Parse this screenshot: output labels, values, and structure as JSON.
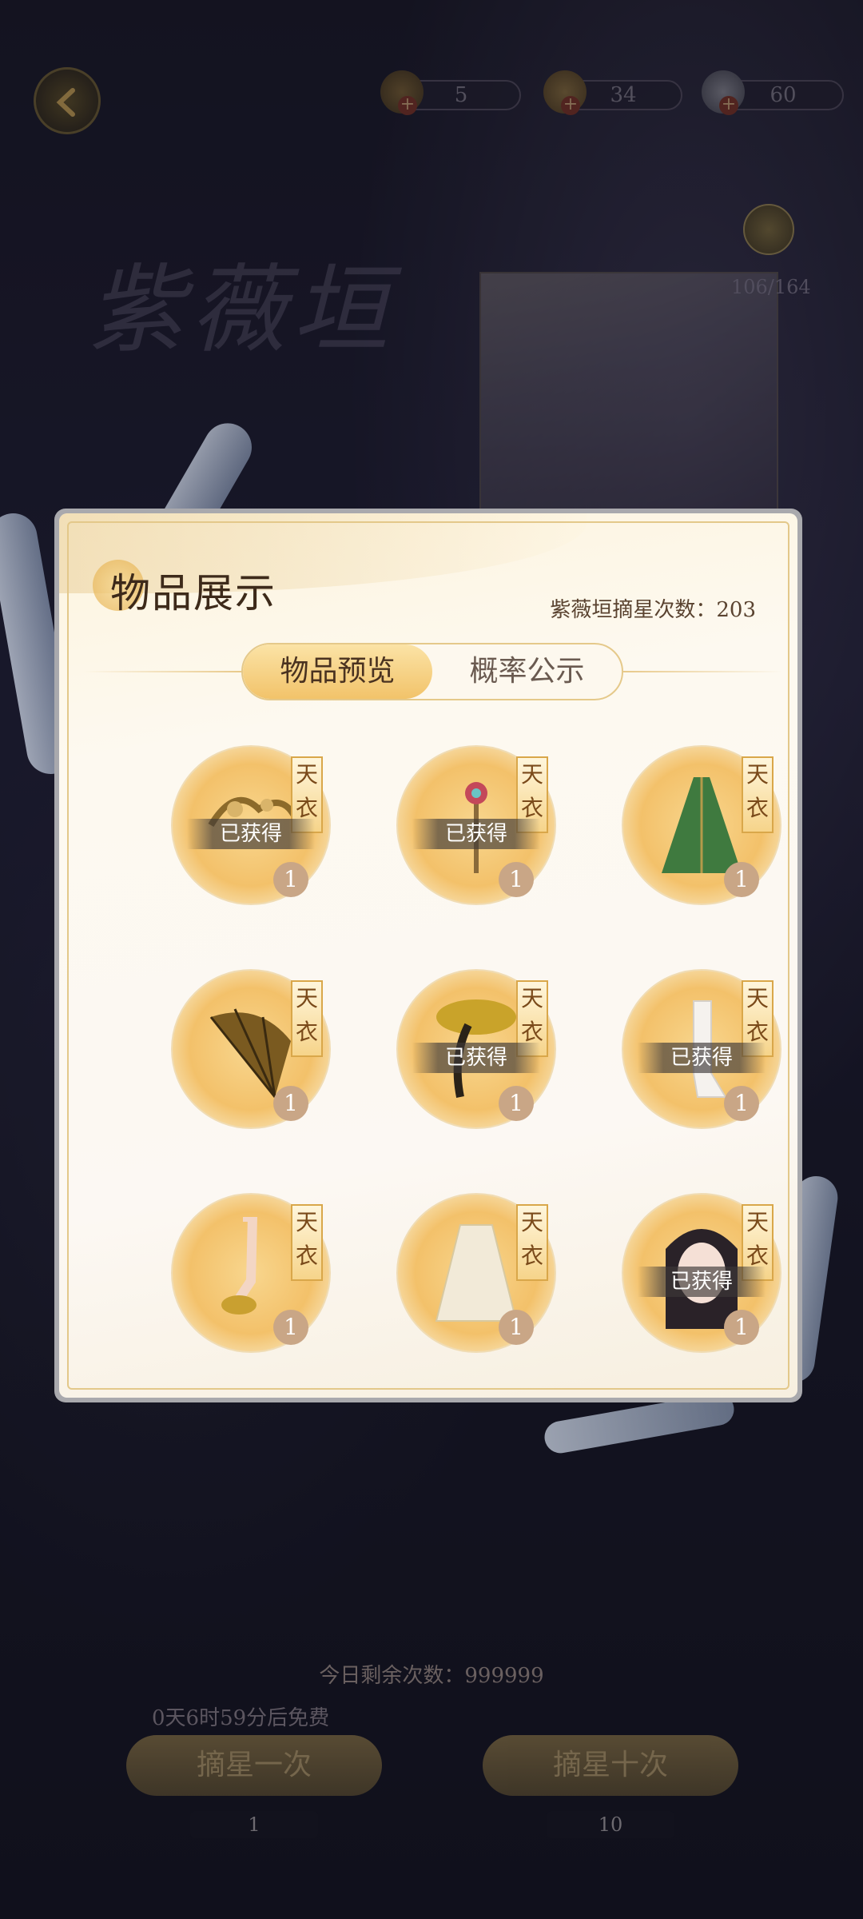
{
  "header": {
    "currencies": [
      {
        "icon": "star-token-icon",
        "value": "5"
      },
      {
        "icon": "coin-icon",
        "value": "34"
      },
      {
        "icon": "pearl-icon",
        "value": "60"
      }
    ],
    "banner_title": "紫薇垣",
    "progress": "106/164"
  },
  "modal": {
    "title": "物品展示",
    "draw_count_label": "紫薇垣摘星次数：203",
    "tabs": [
      {
        "label": "物品预览",
        "active": true
      },
      {
        "label": "概率公示",
        "active": false
      }
    ],
    "items": [
      {
        "name": "hairpiece",
        "tag": "天衣",
        "obtained": "已获得",
        "qty": "1"
      },
      {
        "name": "hairpin",
        "tag": "天衣",
        "obtained": "已获得",
        "qty": "1"
      },
      {
        "name": "green-skirt",
        "tag": "天衣",
        "obtained": "",
        "qty": "1"
      },
      {
        "name": "folding-fan",
        "tag": "天衣",
        "obtained": "",
        "qty": "1"
      },
      {
        "name": "golden-tree",
        "tag": "天衣",
        "obtained": "已获得",
        "qty": "1"
      },
      {
        "name": "white-stockings",
        "tag": "天衣",
        "obtained": "已获得",
        "qty": "1"
      },
      {
        "name": "golden-shoes",
        "tag": "天衣",
        "obtained": "",
        "qty": "1"
      },
      {
        "name": "white-gown",
        "tag": "天衣",
        "obtained": "",
        "qty": "1"
      },
      {
        "name": "black-hair",
        "tag": "天衣",
        "obtained": "已获得",
        "qty": "1"
      }
    ]
  },
  "footer": {
    "remaining": "今日剩余次数：999999",
    "free_timer": "0天6时59分后免费",
    "draw_one": "摘星一次",
    "draw_ten": "摘星十次",
    "cost_one": "1",
    "cost_ten": "10"
  },
  "colors": {
    "accent": "#f2c36a",
    "text_dark": "#3d2a1a"
  }
}
